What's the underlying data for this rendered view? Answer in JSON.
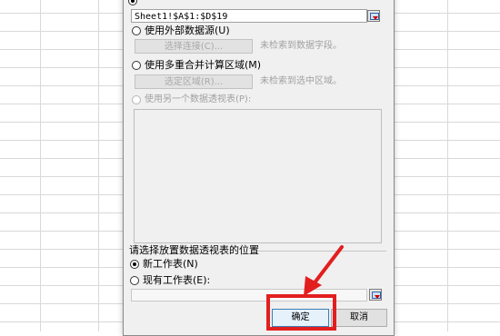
{
  "source": {
    "range_value": "Sheet1!$A$1:$D$19",
    "external_label": "使用外部数据源(U)",
    "choose_connection_label": "选择连接(C)...",
    "no_fields_text": "未检索到数据字段。",
    "multi_range_label": "使用多重合并计算区域(M)",
    "selected_area_label": "选定区域(R)...",
    "no_area_text": "未检索到选中区域。",
    "other_pivot_label": "使用另一个数据透视表(P):"
  },
  "placement": {
    "group_title": "请选择放置数据透视表的位置",
    "new_sheet_label": "新工作表(N)",
    "existing_sheet_label": "现有工作表(E):"
  },
  "buttons": {
    "ok_label": "确定",
    "cancel_label": "取消"
  },
  "colors": {
    "annotation_red": "#e31e1e"
  },
  "icons": {
    "range_picker": "range-picker-icon",
    "annotation_arrow": "red-arrow-annotation"
  }
}
